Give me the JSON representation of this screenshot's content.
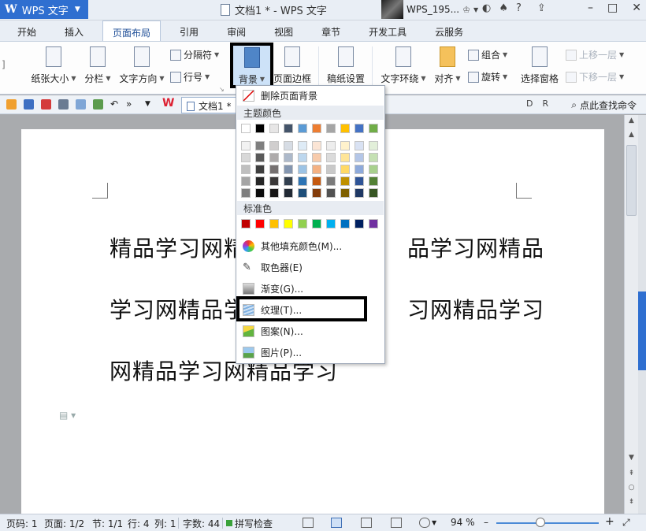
{
  "titlebar": {
    "app_name": "WPS 文字",
    "doc_title": "文档1 * - WPS 文字",
    "user_name": "WPS_195...",
    "icons": [
      "skin-icon",
      "tshirt-icon",
      "help-icon",
      "share-icon"
    ],
    "window_buttons": [
      "minimize-icon",
      "maximize-icon",
      "close-icon"
    ]
  },
  "tabs": [
    "开始",
    "插入",
    "页面布局",
    "引用",
    "审阅",
    "视图",
    "章节",
    "开发工具",
    "云服务"
  ],
  "active_tab": "页面布局",
  "ribbon": {
    "paper_size": "纸张大小",
    "columns": "分栏",
    "text_direction": "文字方向",
    "breaks": "分隔符",
    "line_numbers": "行号",
    "background": "背景",
    "page_border": "页面边框",
    "grid_paper": "稿纸设置",
    "text_wrap": "文字环绕",
    "align": "对齐",
    "group": "组合",
    "rotate": "旋转",
    "selection_pane": "选择窗格",
    "bring_forward": "上移一层",
    "send_backward": "下移一层"
  },
  "quickbar": {
    "doc_tab": "文档1 *",
    "find_command": "点此查找命令"
  },
  "document": {
    "lines": [
      "精品学习网精",
      "品学习网精品",
      "学习网精品学",
      "习网精品学习",
      "网精品学习网精品学习"
    ]
  },
  "menu": {
    "remove_background": "删除页面背景",
    "theme_colors_label": "主题颜色",
    "standard_colors_label": "标准色",
    "more_colors": "其他填充颜色(M)...",
    "eyedropper": "取色器(E)",
    "gradient": "渐变(G)...",
    "texture": "纹理(T)...",
    "pattern": "图案(N)...",
    "picture": "图片(P)...",
    "theme_top_row": [
      "#ffffff",
      "#000000",
      "#e7e6e6",
      "#44546a",
      "#5b9bd5",
      "#ed7d31",
      "#a5a5a5",
      "#ffc000",
      "#4472c4",
      "#70ad47"
    ],
    "theme_shades": [
      [
        "#f2f2f2",
        "#7f7f7f",
        "#d0cece",
        "#d6dce4",
        "#deebf6",
        "#fbe5d5",
        "#ededed",
        "#fff2cc",
        "#d9e2f3",
        "#e2efd9"
      ],
      [
        "#d8d8d8",
        "#595959",
        "#aeabab",
        "#adb9ca",
        "#bdd7ee",
        "#f7cbac",
        "#dbdbdb",
        "#fee599",
        "#b4c6e7",
        "#c5e0b3"
      ],
      [
        "#bfbfbf",
        "#3f3f3f",
        "#757070",
        "#8496b0",
        "#9cc3e5",
        "#f4b183",
        "#c9c9c9",
        "#ffd965",
        "#8eaadb",
        "#a8d08d"
      ],
      [
        "#a5a5a5",
        "#262626",
        "#3a3838",
        "#323f4f",
        "#2e75b5",
        "#c55a11",
        "#7b7b7b",
        "#bf9000",
        "#2f5496",
        "#538135"
      ],
      [
        "#7f7f7f",
        "#0c0c0c",
        "#171616",
        "#222a35",
        "#1e4e79",
        "#833c0b",
        "#525252",
        "#7f6000",
        "#1f3864",
        "#375623"
      ]
    ],
    "standard_colors": [
      "#c00000",
      "#ff0000",
      "#ffc000",
      "#ffff00",
      "#92d050",
      "#00b050",
      "#00b0f0",
      "#0070c0",
      "#002060",
      "#7030a0"
    ]
  },
  "status": {
    "page": "页码: 1",
    "pages": "页面: 1/2",
    "section": "节: 1/1",
    "row": "行: 4",
    "column": "列: 1",
    "word_count": "字数: 44",
    "spell_check": "拼写检查",
    "zoom": "94 %",
    "zoom_level": 0.43
  }
}
